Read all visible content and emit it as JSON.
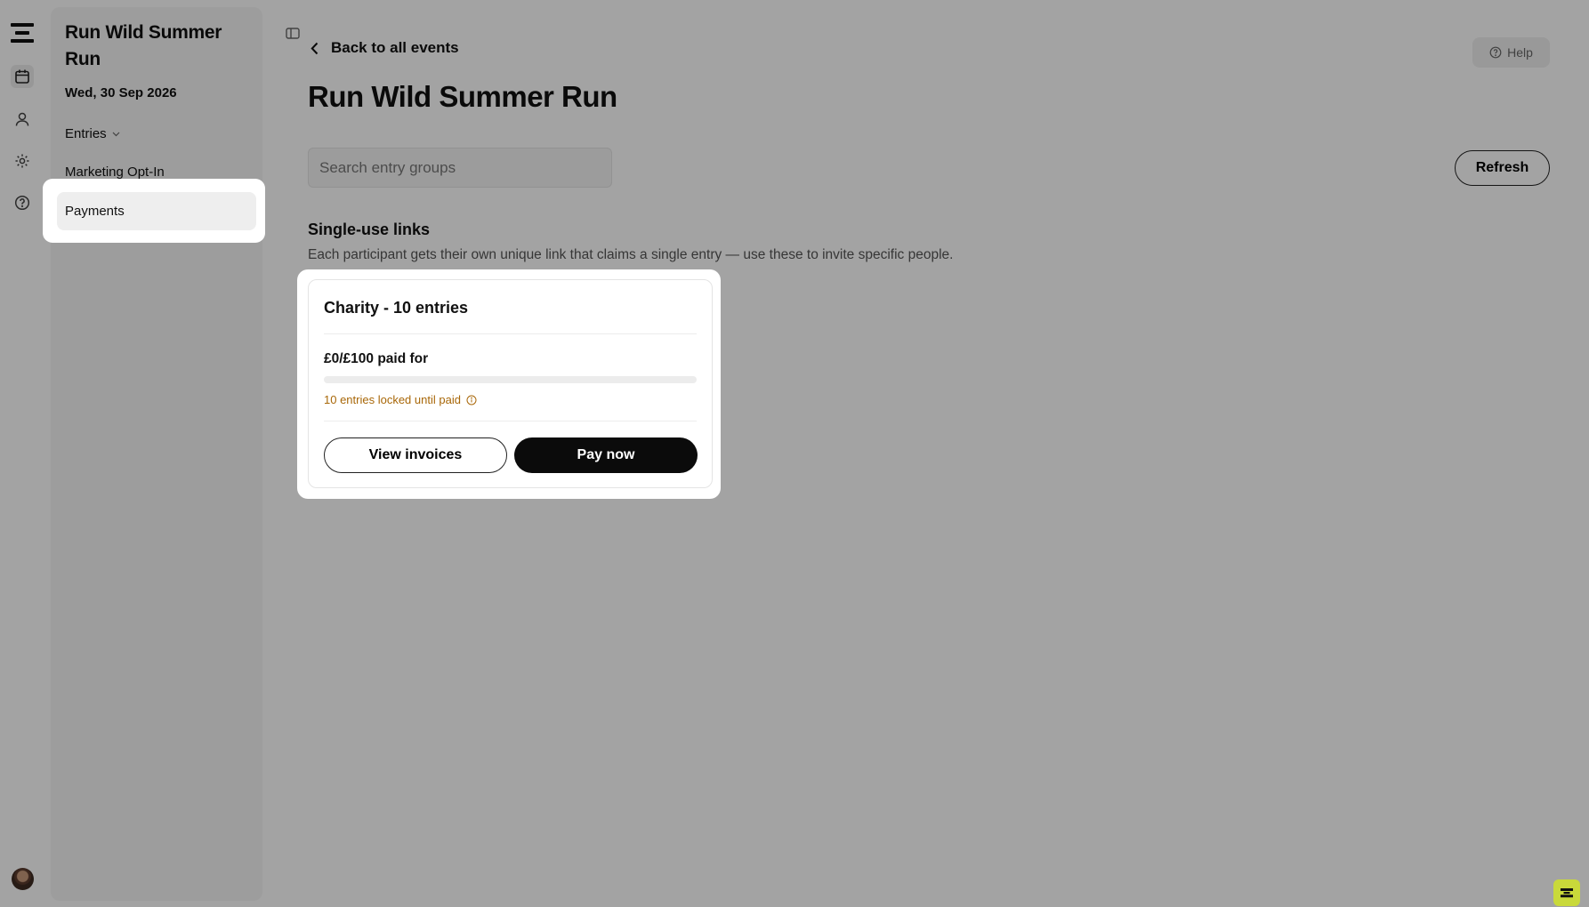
{
  "rail": {
    "icons": [
      "calendar-icon",
      "user-icon",
      "gear-icon",
      "help-circle-icon"
    ]
  },
  "sidebar": {
    "event_title": "Run Wild Summer Run",
    "event_date": "Wed, 30 Sep 2026",
    "entries_label": "Entries",
    "marketing_label": "Marketing Opt-In",
    "payments_label": "Payments"
  },
  "header": {
    "back_label": "Back to all events",
    "help_label": "Help"
  },
  "main": {
    "title": "Run Wild Summer Run",
    "search_placeholder": "Search entry groups",
    "refresh_label": "Refresh",
    "section_title": "Single-use links",
    "section_desc": "Each participant gets their own unique link that claims a single entry — use these to invite specific people."
  },
  "card": {
    "title": "Charity - 10 entries",
    "paid_text": "£0/£100 paid for",
    "paid_fraction": 0,
    "locked_text": "10 entries locked until paid",
    "view_invoices_label": "View invoices",
    "pay_now_label": "Pay now"
  },
  "colors": {
    "warning": "#a86708",
    "primary_button": "#0b0b0b",
    "chat_accent": "#c9d93a"
  }
}
